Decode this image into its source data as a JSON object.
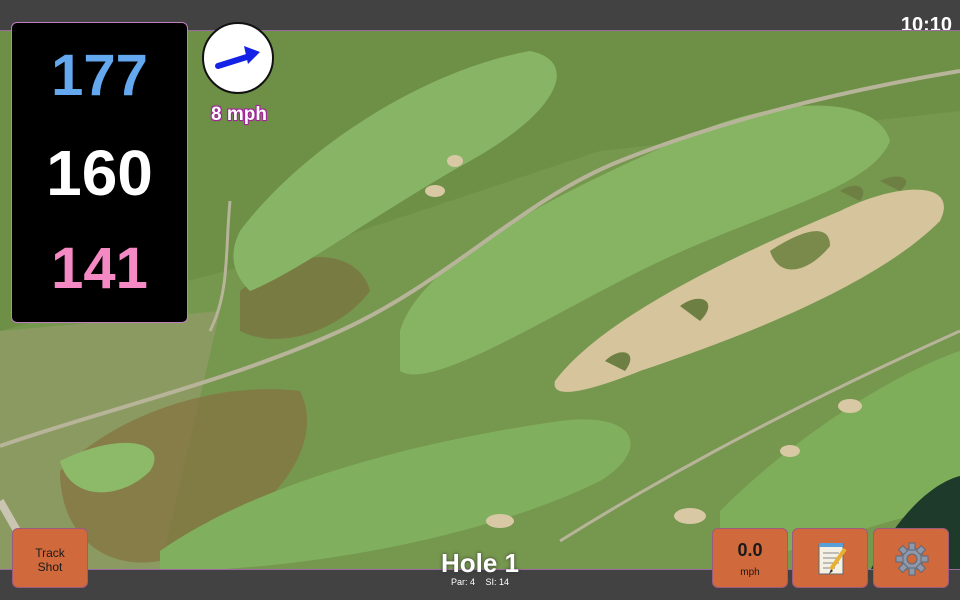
{
  "status_bar": {
    "time": "10:10"
  },
  "distances": {
    "back": "177",
    "middle": "160",
    "front": "141"
  },
  "wind": {
    "speed_label": "8 mph",
    "icon": "arrow-icon"
  },
  "hole": {
    "title": "Hole 1",
    "par": "Par: 4",
    "stroke_index": "SI: 14"
  },
  "buttons": {
    "track_shot_line1": "Track",
    "track_shot_line2": "Shot",
    "speed_value": "0.0",
    "speed_unit": "mph",
    "notes_icon": "notepad-icon",
    "settings_icon": "gear-icon"
  },
  "colors": {
    "back_distance": "#64a8f0",
    "middle_distance": "#ffffff",
    "front_distance": "#f489c4",
    "button_orange": "#d0693b"
  }
}
